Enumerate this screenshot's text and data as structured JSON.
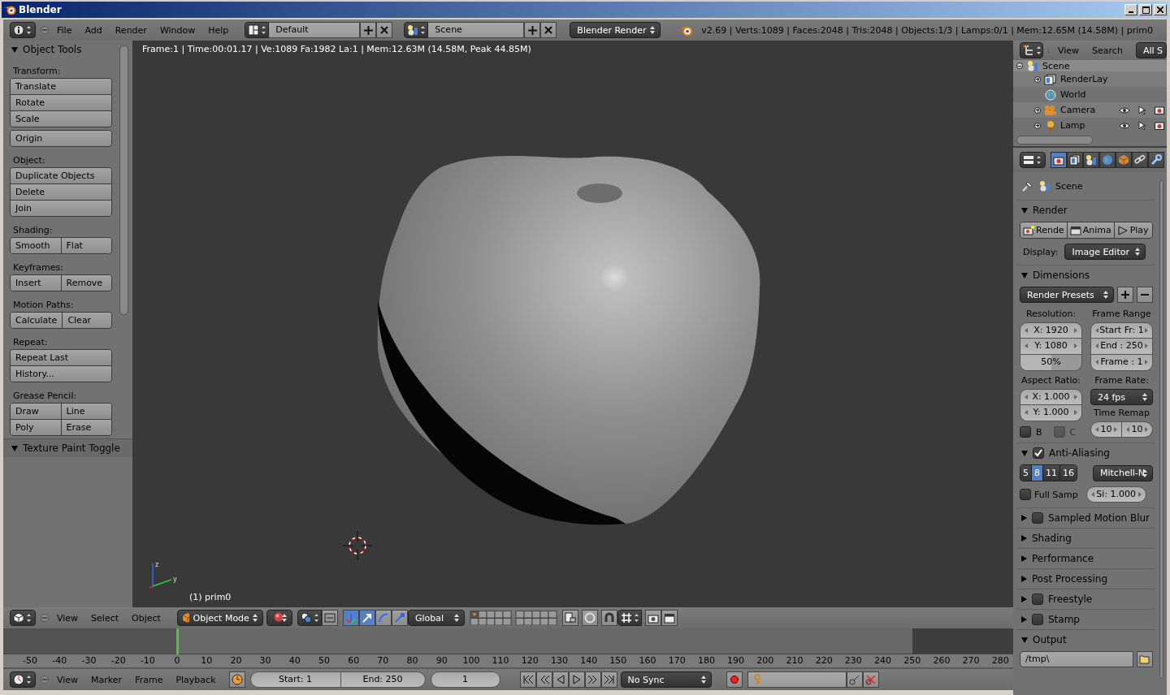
{
  "window": {
    "title": "Blender"
  },
  "info_header": {
    "menus": [
      "File",
      "Add",
      "Render",
      "Window",
      "Help"
    ],
    "screen_layout": "Default",
    "scene": "Scene",
    "render_engine": "Blender Render",
    "stats": "v2.69 | Verts:1089 | Faces:2048 | Tris:2048 | Objects:1/3 | Lamps:0/1 | Mem:12.65M (14.58M) | prim0"
  },
  "tool_shelf": {
    "panels": [
      {
        "title": "Object Tools",
        "expanded": true,
        "sections": [
          {
            "label": "Transform:",
            "blocks": [
              [
                [
                  "Translate"
                ],
                [
                  "Rotate"
                ],
                [
                  "Scale"
                ]
              ],
              [
                [
                  "Origin"
                ]
              ]
            ]
          },
          {
            "label": "Object:",
            "blocks": [
              [
                [
                  "Duplicate Objects"
                ],
                [
                  "Delete"
                ],
                [
                  "Join"
                ]
              ]
            ]
          },
          {
            "label": "Shading:",
            "blocks": [
              [
                [
                  "Smooth",
                  "Flat"
                ]
              ]
            ]
          },
          {
            "label": "Keyframes:",
            "blocks": [
              [
                [
                  "Insert",
                  "Remove"
                ]
              ]
            ]
          },
          {
            "label": "Motion Paths:",
            "blocks": [
              [
                [
                  "Calculate",
                  "Clear"
                ]
              ]
            ]
          },
          {
            "label": "Repeat:",
            "blocks": [
              [
                [
                  "Repeat Last"
                ],
                [
                  "History..."
                ]
              ]
            ]
          },
          {
            "label": "Grease Pencil:",
            "blocks": [
              [
                [
                  "Draw",
                  "Line"
                ],
                [
                  "Poly",
                  "Erase"
                ]
              ]
            ]
          }
        ]
      },
      {
        "title": "Texture Paint Toggle",
        "expanded": true
      }
    ]
  },
  "viewport": {
    "info": "Frame:1 | Time:00:01.17 | Ve:1089 Fa:1982 La:1 | Mem:12.63M (14.58M, Peak 44.85M)",
    "object_label": "(1) prim0",
    "axis_labels": [
      "z",
      "y"
    ]
  },
  "view3d_header": {
    "menus": [
      "View",
      "Select",
      "Object"
    ],
    "mode": "Object Mode",
    "orientation": "Global"
  },
  "timeline": {
    "ticks": [
      "-50",
      "-40",
      "-30",
      "-20",
      "-10",
      "0",
      "10",
      "20",
      "30",
      "40",
      "50",
      "60",
      "70",
      "80",
      "90",
      "100",
      "110",
      "120",
      "130",
      "140",
      "150",
      "160",
      "170",
      "180",
      "190",
      "200",
      "210",
      "220",
      "230",
      "240",
      "250",
      "260",
      "270",
      "280"
    ],
    "menus": [
      "View",
      "Marker",
      "Frame",
      "Playback"
    ],
    "start": "Start: 1",
    "end": "End: 250",
    "current_frame": "1",
    "sync": "No Sync"
  },
  "outliner": {
    "menus": [
      "View",
      "Search"
    ],
    "filter": "All S",
    "tree": [
      {
        "name": "Scene",
        "kind": "scene",
        "expanded": true,
        "children": [
          {
            "name": "RenderLay",
            "kind": "layers",
            "expanded": false
          },
          {
            "name": "World",
            "kind": "world"
          },
          {
            "name": "Camera",
            "kind": "camera",
            "expanded": false
          },
          {
            "name": "Lamp",
            "kind": "lamp",
            "expanded": false
          }
        ]
      }
    ]
  },
  "properties": {
    "tabs": [
      {
        "kind": "render",
        "selected": true
      },
      {
        "kind": "layers",
        "selected": false
      },
      {
        "kind": "scene",
        "selected": false
      },
      {
        "kind": "world",
        "selected": false
      },
      {
        "kind": "object",
        "selected": false
      },
      {
        "kind": "constraints",
        "selected": false
      },
      {
        "kind": "modifiers",
        "selected": false
      }
    ],
    "context": "Scene",
    "render": {
      "title": "Render",
      "expanded": true,
      "buttons": [
        "Rende",
        "Anima",
        "Play"
      ],
      "display_label": "Display:",
      "display": "Image Editor"
    },
    "dimensions": {
      "title": "Dimensions",
      "expanded": true,
      "presets": "Render Presets",
      "resolution_label": "Resolution:",
      "resolution_x": "X: 1920",
      "resolution_y": "Y: 1080",
      "percentage": {
        "text": "50%",
        "level": 0.5
      },
      "frame_range_label": "Frame Range",
      "frame_start": "Start Fr: 1",
      "frame_end": "End : 250",
      "frame_step": "Frame : 1",
      "aspect_label": "Aspect Ratio:",
      "aspect_x": "X: 1.000",
      "aspect_y": "Y: 1.000",
      "frame_rate_label": "Frame Rate:",
      "frame_rate": "24 fps",
      "border": {
        "label": "B",
        "checked": false,
        "disabled": false
      },
      "crop": {
        "label": "C",
        "checked": false,
        "disabled": true
      },
      "time_remap_label": "Time Remap",
      "remap_old": "10",
      "remap_new": "10"
    },
    "anti_aliasing": {
      "title": "Anti-Aliasing",
      "expanded": true,
      "enabled": true,
      "samples": [
        {
          "label": "5",
          "selected": false
        },
        {
          "label": "8",
          "selected": true
        },
        {
          "label": "11",
          "selected": false
        },
        {
          "label": "16",
          "selected": false
        }
      ],
      "filter": "Mitchell-N",
      "full_sample": {
        "label": "Full Samp",
        "checked": false
      },
      "size": "Si: 1.000"
    },
    "collapsed_panels": [
      {
        "title": "Sampled Motion Blur",
        "expanded": false,
        "enabled": false
      },
      {
        "title": "Shading",
        "expanded": false
      },
      {
        "title": "Performance",
        "expanded": false
      },
      {
        "title": "Post Processing",
        "expanded": false
      },
      {
        "title": "Freestyle",
        "expanded": false,
        "enabled": false
      },
      {
        "title": "Stamp",
        "expanded": false,
        "enabled": false
      }
    ],
    "output": {
      "title": "Output",
      "expanded": true,
      "path": "/tmp\\"
    }
  }
}
